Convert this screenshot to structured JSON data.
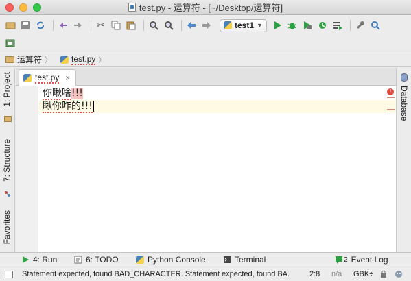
{
  "window": {
    "title": "test.py - 运算符 - [~/Desktop/运算符]"
  },
  "toolbar": {
    "run_config": "test1"
  },
  "navbar": {
    "crumbs": [
      "运算符",
      "test.py"
    ]
  },
  "side_tabs": {
    "left": [
      "1: Project",
      "7: Structure",
      "Favorites"
    ],
    "right": [
      "Database"
    ]
  },
  "editor_tab": {
    "label": "test.py",
    "close": "×"
  },
  "editor": {
    "lines": [
      {
        "normal": "你瞅啥",
        "error": "!!!"
      },
      {
        "normal": "瞅你咋的",
        "error": "!!!"
      }
    ],
    "error_marker": "!"
  },
  "bottom_tools": [
    {
      "label": "4: Run",
      "icon": "run-triangle-icon"
    },
    {
      "label": "6: TODO",
      "icon": "todo-icon"
    },
    {
      "label": "Python Console",
      "icon": "python-console-icon"
    },
    {
      "label": "Terminal",
      "icon": "terminal-icon"
    },
    {
      "label": "Event Log",
      "icon": "event-log-icon",
      "badge": "2"
    }
  ],
  "status": {
    "message": "Statement expected, found BAD_CHARACTER. Statement expected, found BA.",
    "position": "2:8",
    "line_sep": "n/a",
    "encoding": "GBK÷"
  },
  "colors": {
    "run_green": "#2ea043",
    "error_red": "#e0483e",
    "current_line": "#fffae3"
  }
}
